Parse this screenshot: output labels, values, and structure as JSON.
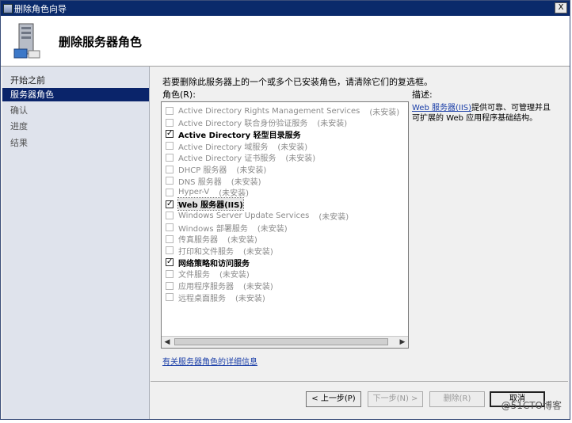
{
  "window": {
    "title": "删除角色向导",
    "close_label": "X"
  },
  "header": {
    "title": "删除服务器角色",
    "icon": "server-icon"
  },
  "sidebar": {
    "items": [
      {
        "label": "开始之前",
        "state": "normal"
      },
      {
        "label": "服务器角色",
        "state": "active"
      },
      {
        "label": "确认",
        "state": "muted"
      },
      {
        "label": "进度",
        "state": "muted"
      },
      {
        "label": "结果",
        "state": "muted"
      }
    ]
  },
  "main": {
    "instruction": "若要删除此服务器上的一个或多个已安装角色，请清除它们的复选框。",
    "roles_label": "角色(R):",
    "description_label": "描述:",
    "roles": [
      {
        "name": "Active Directory Rights Management Services",
        "status": "(未安装)",
        "checked": false,
        "installed": false
      },
      {
        "name": "Active Directory 联合身份验证服务",
        "status": "(未安装)",
        "checked": false,
        "installed": false
      },
      {
        "name": "Active Directory 轻型目录服务",
        "status": "",
        "checked": true,
        "installed": true
      },
      {
        "name": "Active Directory 域服务",
        "status": "(未安装)",
        "checked": false,
        "installed": false
      },
      {
        "name": "Active Directory 证书服务",
        "status": "(未安装)",
        "checked": false,
        "installed": false
      },
      {
        "name": "DHCP 服务器",
        "status": "(未安装)",
        "checked": false,
        "installed": false
      },
      {
        "name": "DNS 服务器",
        "status": "(未安装)",
        "checked": false,
        "installed": false
      },
      {
        "name": "Hyper-V",
        "status": "(未安装)",
        "checked": false,
        "installed": false
      },
      {
        "name": "Web 服务器(IIS)",
        "status": "",
        "checked": true,
        "installed": true,
        "selected": true
      },
      {
        "name": "Windows Server Update Services",
        "status": "(未安装)",
        "checked": false,
        "installed": false
      },
      {
        "name": "Windows 部署服务",
        "status": "(未安装)",
        "checked": false,
        "installed": false
      },
      {
        "name": "传真服务器",
        "status": "(未安装)",
        "checked": false,
        "installed": false
      },
      {
        "name": "打印和文件服务",
        "status": "(未安装)",
        "checked": false,
        "installed": false
      },
      {
        "name": "网络策略和访问服务",
        "status": "",
        "checked": true,
        "installed": true
      },
      {
        "name": "文件服务",
        "status": "(未安装)",
        "checked": false,
        "installed": false
      },
      {
        "name": "应用程序服务器",
        "status": "(未安装)",
        "checked": false,
        "installed": false
      },
      {
        "name": "远程桌面服务",
        "status": "(未安装)",
        "checked": false,
        "installed": false
      }
    ],
    "description": {
      "link": "Web 服务器(IIS)",
      "text": "提供可靠、可管理并且可扩展的 Web 应用程序基础结构。"
    },
    "more_info_link": "有关服务器角色的详细信息"
  },
  "buttons": {
    "prev": "< 上一步(P)",
    "next": "下一步(N) >",
    "remove": "删除(R)",
    "cancel": "取消"
  },
  "watermark": "@51CTO博客"
}
